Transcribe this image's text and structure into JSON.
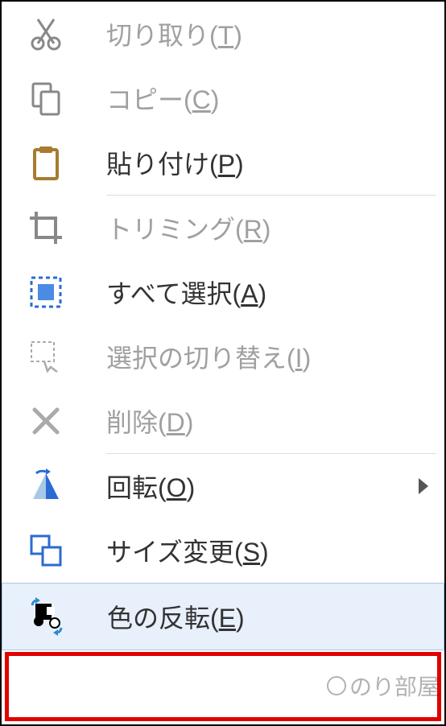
{
  "menu": {
    "items": [
      {
        "label_pre": "切り取り(",
        "hotkey": "T",
        "label_post": ")",
        "icon": "cut-icon",
        "disabled": true
      },
      {
        "label_pre": "コピー(",
        "hotkey": "C",
        "label_post": ")",
        "icon": "copy-icon",
        "disabled": true
      },
      {
        "label_pre": "貼り付け(",
        "hotkey": "P",
        "label_post": ")",
        "icon": "paste-icon",
        "disabled": false
      }
    ],
    "items2": [
      {
        "label_pre": "トリミング(",
        "hotkey": "R",
        "label_post": ")",
        "icon": "crop-icon",
        "disabled": true
      },
      {
        "label_pre": "すべて選択(",
        "hotkey": "A",
        "label_post": ")",
        "icon": "select-all-icon",
        "disabled": false
      },
      {
        "label_pre": "選択の切り替え(",
        "hotkey": "I",
        "label_post": ")",
        "icon": "select-toggle-icon",
        "disabled": true
      },
      {
        "label_pre": "削除(",
        "hotkey": "D",
        "label_post": ")",
        "icon": "delete-icon",
        "disabled": true
      }
    ],
    "items3": [
      {
        "label_pre": "回転(",
        "hotkey": "O",
        "label_post": ")",
        "icon": "rotate-icon",
        "disabled": false,
        "submenu": true
      },
      {
        "label_pre": "サイズ変更(",
        "hotkey": "S",
        "label_post": ")",
        "icon": "resize-icon",
        "disabled": false
      },
      {
        "label_pre": "色の反転(",
        "hotkey": "E",
        "label_post": ")",
        "icon": "invert-icon",
        "disabled": false,
        "highlight": true
      }
    ]
  },
  "watermark": {
    "text": "のり部屋"
  }
}
